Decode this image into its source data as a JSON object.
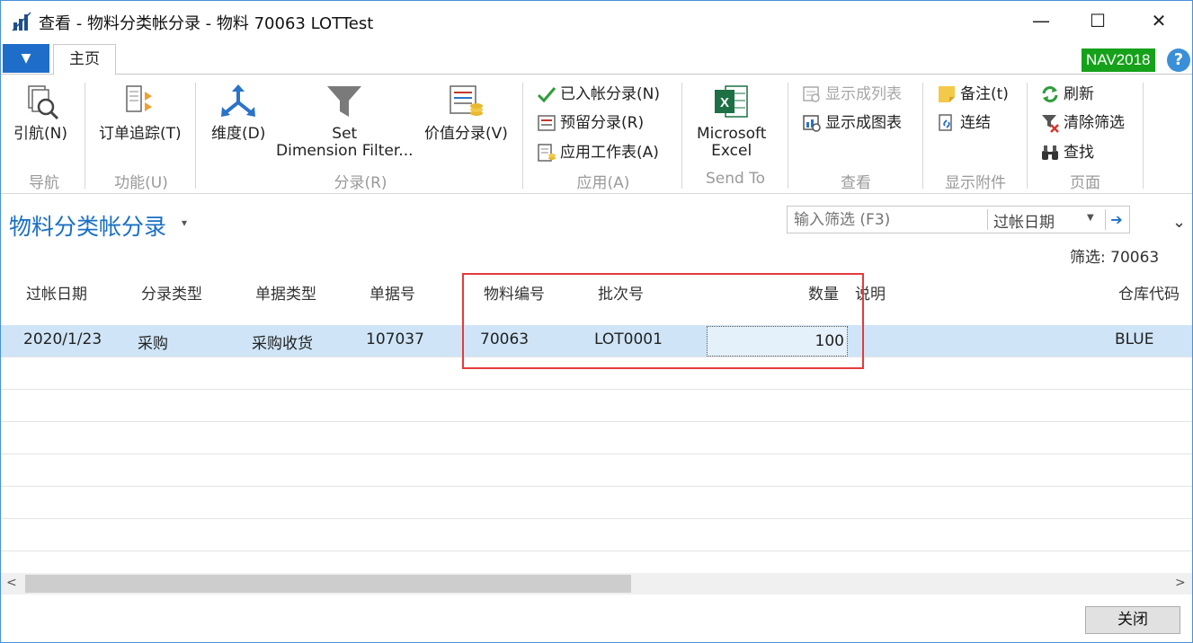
{
  "window": {
    "title": "查看 - 物料分类帐分录 - 物料 70063 LOTTest",
    "minimize": "—",
    "maximize": "☐",
    "close": "✕"
  },
  "ribbon_tabs": {
    "file_button": "▼",
    "home_tab": "主页",
    "version_badge": "NAV2018",
    "help": "?"
  },
  "ribbon": {
    "groups": {
      "navigate": "导航",
      "functions": "功能(U)",
      "entries": "分录(R)",
      "apply": "应用(A)",
      "send_to": "Send To",
      "view": "查看",
      "attachments": "显示附件",
      "page": "页面"
    },
    "buttons": {
      "navigate": "引航(N)",
      "order_tracking": "订单追踪(T)",
      "dimensions": "维度(D)",
      "set_dimension_filter_line1": "Set",
      "set_dimension_filter_line2": "Dimension Filter...",
      "value_entries": "价值分录(V)",
      "applied_entries": "已入帐分录(N)",
      "reservation_entries": "预留分录(R)",
      "application_worksheet": "应用工作表(A)",
      "excel_line1": "Microsoft",
      "excel_line2": "Excel",
      "show_as_list": "显示成列表",
      "show_as_chart": "显示成图表",
      "notes": "备注(t)",
      "links": "连结",
      "refresh": "刷新",
      "clear_filter": "清除筛选",
      "find": "查找"
    }
  },
  "page": {
    "title": "物料分类帐分录",
    "filter_placeholder": "输入筛选 (F3)",
    "filter_field": "过帐日期",
    "filter_status": "筛选: 70063"
  },
  "grid": {
    "columns": [
      "过帐日期",
      "分录类型",
      "单据类型",
      "单据号",
      "物料编号",
      "批次号",
      "数量",
      "说明",
      "仓库代码"
    ],
    "rows": [
      {
        "posting_date": "2020/1/23",
        "entry_type": "采购",
        "document_type": "采购收货",
        "document_no": "107037",
        "item_no": "70063",
        "lot_no": "LOT0001",
        "quantity": "100",
        "description": "",
        "location_code": "BLUE"
      }
    ]
  },
  "footer": {
    "close_button": "关闭"
  },
  "colors": {
    "accent": "#1a6fc4",
    "selected_row": "#cfe5f7",
    "badge": "#16a11a",
    "highlight": "#e53b3b"
  }
}
